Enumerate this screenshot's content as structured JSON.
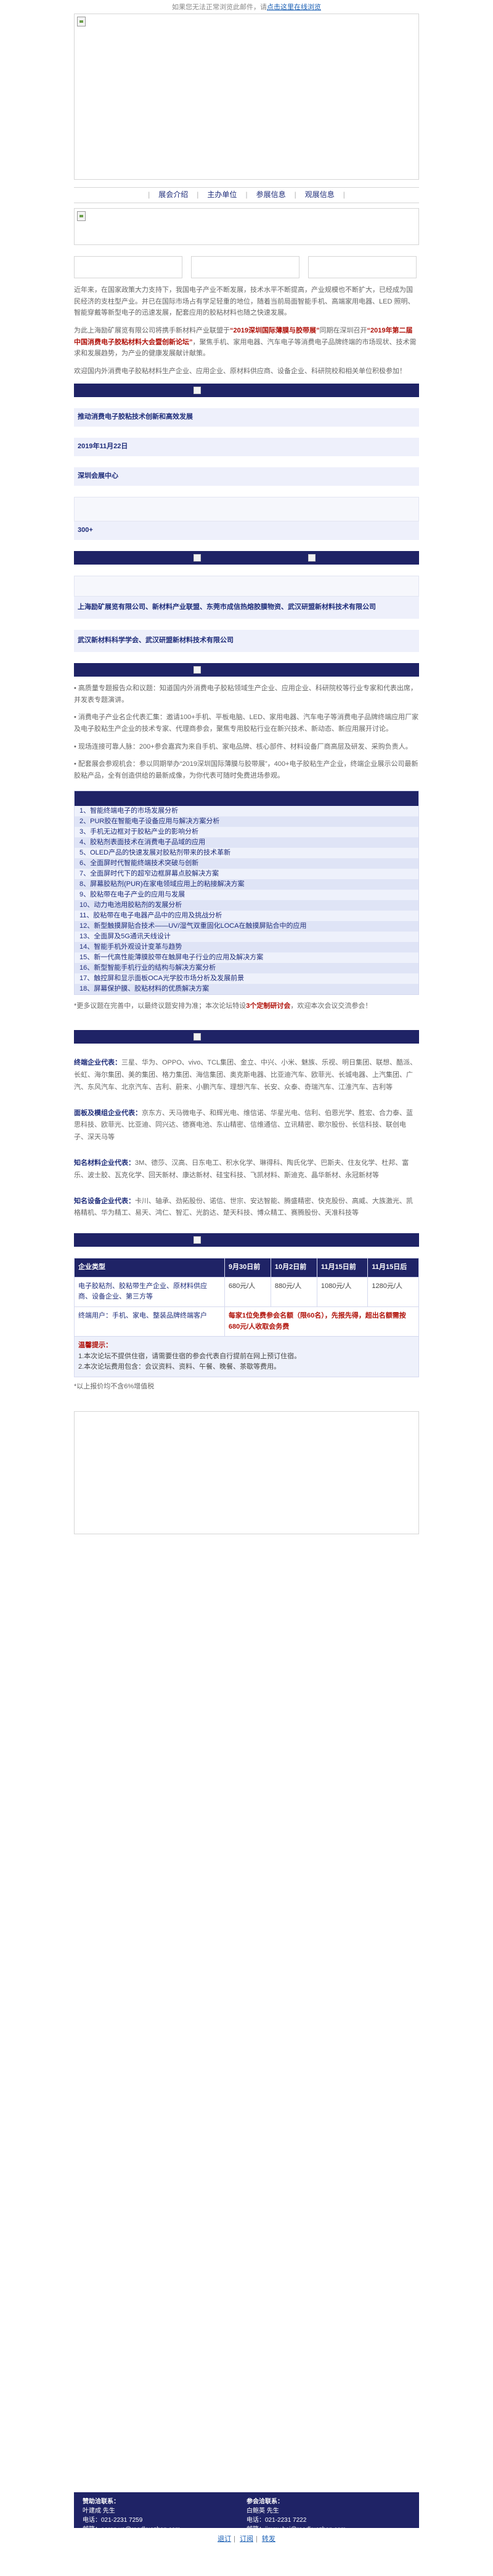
{
  "notice": {
    "text": "如果您无法正常浏览此邮件，请",
    "link": "点击这里在线浏览"
  },
  "nav": {
    "items": [
      {
        "label": "展会介绍",
        "href": "#intro"
      },
      {
        "label": "主办单位",
        "href": "#org"
      },
      {
        "label": "参展信息",
        "href": "#exhibit"
      },
      {
        "label": "观展信息",
        "href": "#visit"
      }
    ]
  },
  "intro": {
    "p1": "近年来，在国家政策大力支持下，我国电子产业不断发展，技术水平不断提高，产业规模也不断扩大，已经成为国民经济的支柱型产业。并已在国际市场占有学足轻重的地位，随着当前局面智能手机、高端家用电器、LED 照明、智能穿戴等新型电子的迅速发展，配套应用的胶粘材料也随之快速发展。",
    "p2_a": "为此上海励矿展览有限公司将携手新材料产业联盟于",
    "p2_hl": "“2019深圳国际薄膜与胶带展”",
    "p2_b": "同期在深圳召开",
    "p2_hl2": "“2019年第二届中国消费电子胶粘材料大会暨创新论坛”",
    "p2_c": "，聚焦手机、家用电器、汽车电子等消费电子品牌终端的市场现状、技术需求和发展趋势，为产业的健康发展献计献策。",
    "p3": "欢迎国内外消费电子胶粘材料生产企业、应用企业、原材料供应商、设备企业、科研院校和相关单位积极参加！"
  },
  "event": {
    "name": "推动消费电子胶粘技术创新和高效发展",
    "date": "2019年11月22日",
    "venue": "深圳会展中心",
    "scale": "300+"
  },
  "organizers": {
    "line1": "上海励矿展览有限公司、新材料产业联盟、东莞市成信热熔胶膜物资、武汉研盟新材料技术有限公司",
    "line2": "武汉新材料科学学会、武汉研盟新材料技术有限公司"
  },
  "bullets": [
    "• 高质量专题报告众和议题：知道国内外消费电子胶粘领域生产企业、应用企业、科研院校等行业专家和代表出席，并发表专题演讲。",
    "• 消费电子产业名企代表汇集：邀请100+手机、平板电脑、LED、家用电器、汽车电子等消费电子品牌终端应用厂家及电子胶粘生产企业的技术专家、代理商参会，聚焦专用胶粘行业在新兴技术、新动态、新应用展开讨论。",
    "• 现场连接可靠人脉：200+参会嘉宾为来自手机、家电品牌、核心部件、材料设备厂商高层及研发、采购负责人。",
    "• 配套展会参观机会：参以同期举办“2019深圳国际薄膜与胶带展”，400+电子胶粘生产企业，终端企业展示公司最新胶粘产品，全有创造供给的最新成像，为你代表可随时免费进场参观。"
  ],
  "topics": [
    "1、智能终端电子的市场发展分析",
    "2、PUR胶在智能电子设备应用与解决方案分析",
    "3、手机无边框对于胶粘产业的影响分析",
    "4、胶粘剂表面技术在消费电子品域的应用",
    "5、OLED产品的快速发展对胶粘剂带来的技术革新",
    "6、全面屏时代智能终端技术突破与创新",
    "7、全面屏时代下的超窄边框屏幕点胶解决方案",
    "8、屏幕胶粘剂(PUR)在家电领域应用上的粘接解决方案",
    "9、胶粘带在电子产业的应用与发展",
    "10、动力电池用胶粘剂的发展分析",
    "11、胶粘带在电子电器产品中的应用及挑战分析",
    "12、新型触摸屏贴合技术——UV/湿气双重固化LOCA在触摸屏贴合中的应用",
    "13、全面屏及5G通讯天线设计",
    "14、智能手机外观设计变革与趋势",
    "15、新一代高性能薄膜胶带在触屏电子行业的应用及解决方案",
    "16、新型智能手机行业的结构与解决方案分析",
    "17、触控屏和显示面板OCA光学胶市场分析及发展前景",
    "18、屏幕保护膜、胶粘材料的优质解决方案"
  ],
  "topics_note": {
    "a": "*更多议题在完善中，以最终议题安排为准；本次论坛特设",
    "b": "3个定制研讨会",
    "c": "，欢迎本次会议交流参会！"
  },
  "groups": [
    {
      "label": "终端企业代表：",
      "text": "三星、华为、OPPO、vivo、TCL集团、金立、中兴、小米、魅族、乐视、明日集团、联想、酷派、长虹、海尔集团、美的集团、格力集团、海信集团、奥克斯电器、比亚迪汽车、欧菲光、长城电器、上汽集团、广汽、东风汽车、北京汽车、吉利、蔚来、小鹏汽车、理想汽车、长安、众泰、奇瑞汽车、江淮汽车、吉利等"
    },
    {
      "label": "面板及模组企业代表：",
      "text": "京东方、天马微电子、和辉光电、维信诺、华星光电、信利、伯恩光学、胜宏、合力泰、蓝思科技、欧菲光、比亚迪、同兴达、德赛电池、东山精密、信维通信、立讯精密、歌尔股份、长信科技、联创电子、深天马等"
    },
    {
      "label": "知名材料企业代表：",
      "text": "3M、德莎、汉高、日东电工、积水化学、琳得科、陶氏化学、巴斯夫、住友化学、杜邦、富乐、波士胶、瓦克化学、回天新材、康达新材、硅宝科技、飞凯材料、斯迪克、晶华新材、永冠新材等"
    },
    {
      "label": "知名设备企业代表：",
      "text": "卡川、轴承、劲拓股份、诺信、世宗、安达智能、腾盛精密、快克股份、高威、大族激光、凯格精机、华为精工、易天、鸿仁、智汇、光韵达、楚天科技、博众精工、赛腾股份、天准科技等"
    }
  ],
  "pricing": {
    "headers": [
      "企业类型",
      "9月30日前",
      "10月2日前",
      "11月15日前",
      "11月15日后"
    ],
    "row1": {
      "type": "电子胶粘剂、胶粘带生产企业、原材料供应商、设备企业、第三方等",
      "p1": "680元/人",
      "p2": "880元/人",
      "p3": "1080元/人",
      "p4": "1280元/人"
    },
    "row2": {
      "type": "终端用户：手机、家电、整装品牌终端客户",
      "note": "每家1位免费参会名额（限60名），先报先得，超出名额需按680元/人收取会务费"
    },
    "tips_title": "温馨提示：",
    "tips": [
      "1.本次论坛不提供住宿，请需要住宿的参会代表自行提前在网上预订住宿。",
      "2.本次论坛费用包含：会议资料、资料、午餐、晚餐、茶歇等费用。"
    ],
    "footnote": "*以上报价均不含6%增值税"
  },
  "footer": {
    "left_title": "赞助洽联系：",
    "left_name": "叶建成 先生",
    "left_tel": "电话：021-2231 7259",
    "left_mail": "邮箱：aaron.ye@reedkuozhan.com",
    "right_title": "参会洽联系：",
    "right_name": "白鲍英 先生",
    "right_tel": "电话：021-2231 7222",
    "right_mail": "邮箱：jimmy.bai@reedkuozhan.com"
  },
  "bottom_links": [
    "退订",
    "订阅",
    "转发"
  ]
}
